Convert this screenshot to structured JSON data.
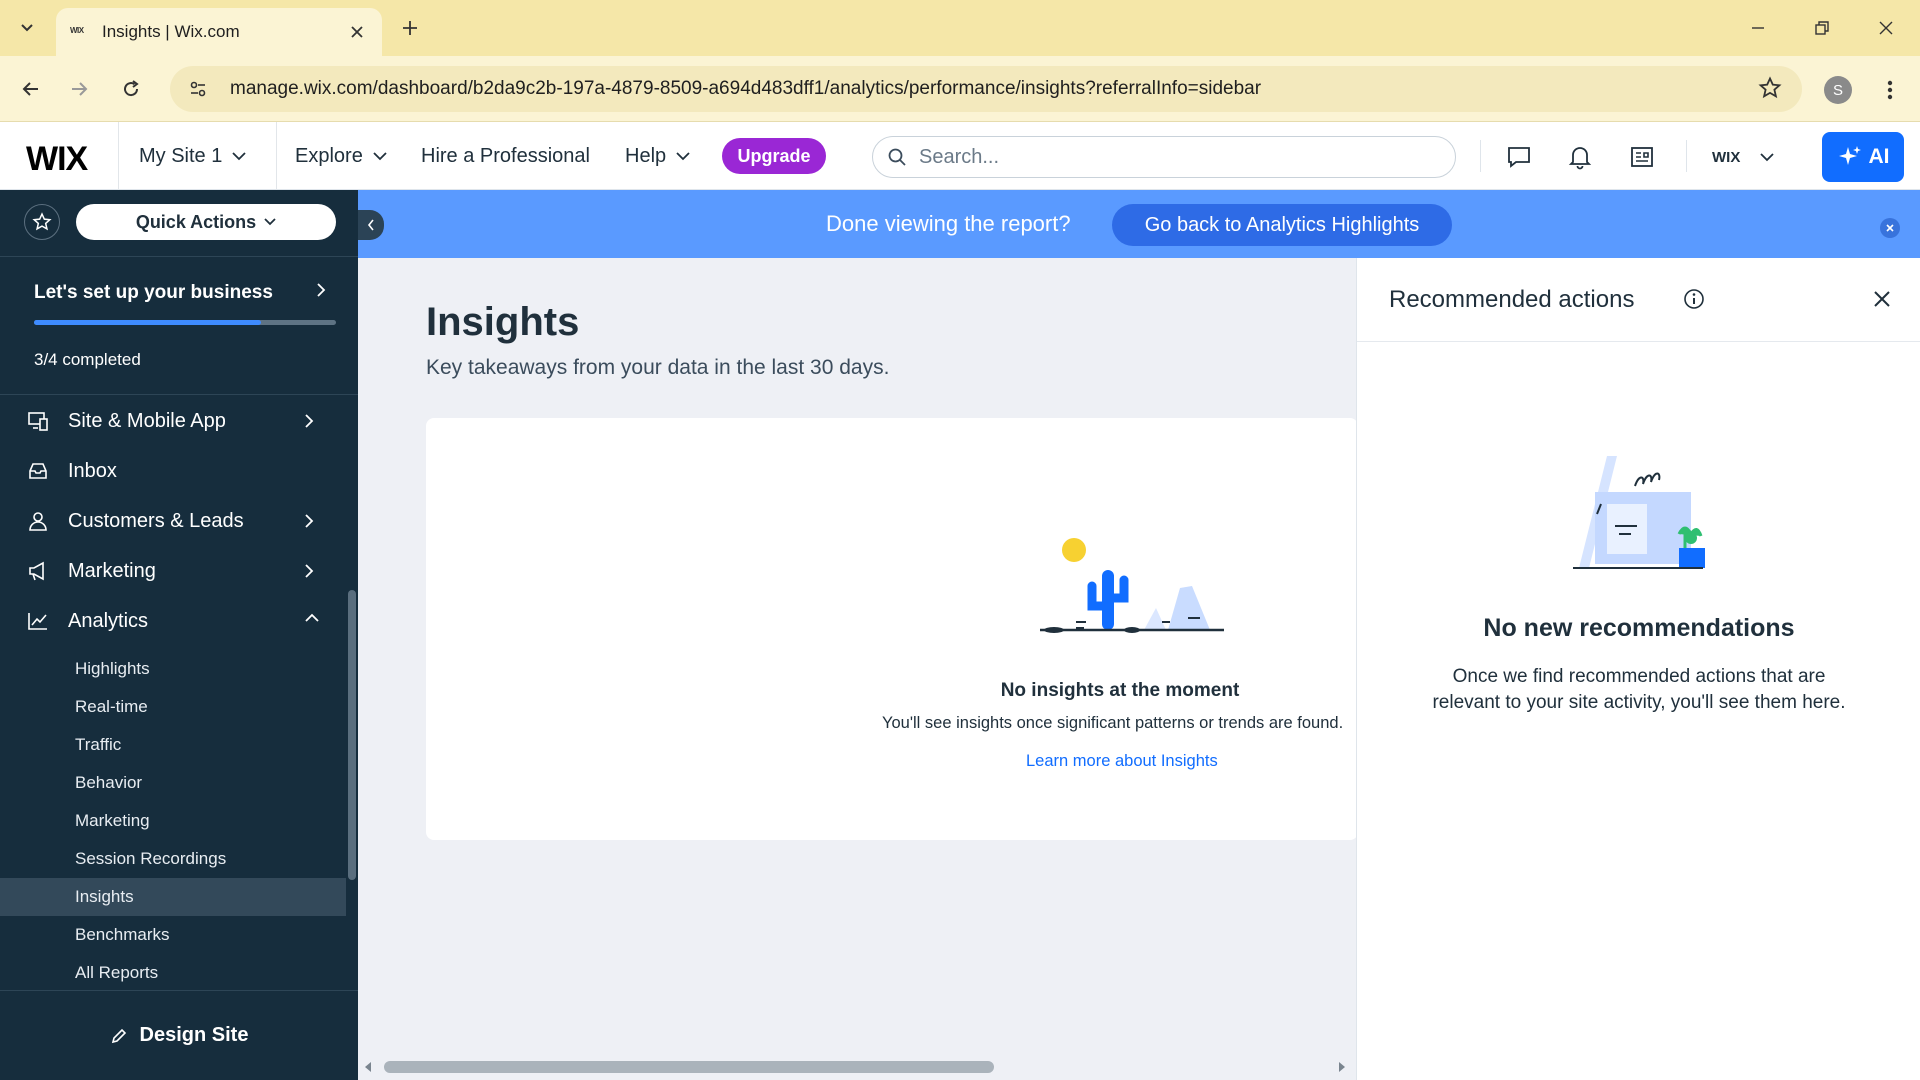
{
  "browser": {
    "tab_title": "Insights | Wix.com",
    "tab_favicon": "WIX",
    "url": "manage.wix.com/dashboard/b2da9c2b-197a-4879-8509-a694d483dff1/analytics/performance/insights?referralInfo=sidebar",
    "profile_initial": "S"
  },
  "header": {
    "logo": "WIX",
    "site_selector": "My Site 1",
    "explore": "Explore",
    "hire": "Hire a Professional",
    "help": "Help",
    "upgrade": "Upgrade",
    "search_placeholder": "Search...",
    "account_label": "WIX",
    "ai_label": "AI"
  },
  "sidebar": {
    "quick_actions": "Quick Actions",
    "setup_title": "Let's set up your business",
    "setup_progress": 0.75,
    "setup_count": "3/4 completed",
    "items": [
      {
        "label": "Site & Mobile App"
      },
      {
        "label": "Inbox"
      },
      {
        "label": "Customers & Leads"
      },
      {
        "label": "Marketing"
      },
      {
        "label": "Analytics"
      }
    ],
    "analytics_sub": [
      {
        "label": "Highlights"
      },
      {
        "label": "Real-time"
      },
      {
        "label": "Traffic"
      },
      {
        "label": "Behavior"
      },
      {
        "label": "Marketing"
      },
      {
        "label": "Session Recordings"
      },
      {
        "label": "Insights"
      },
      {
        "label": "Benchmarks"
      },
      {
        "label": "All Reports"
      }
    ],
    "design_site": "Design Site"
  },
  "banner": {
    "text": "Done viewing the report?",
    "button": "Go back to Analytics Highlights"
  },
  "main": {
    "title": "Insights",
    "subtitle": "Key takeaways from your data in the last 30 days.",
    "empty_title": "No insights at the moment",
    "empty_desc": "You'll see insights once significant patterns or trends are found.",
    "learn_more": "Learn more about Insights"
  },
  "panel": {
    "title": "Recommended actions",
    "empty_title": "No new recommendations",
    "empty_desc": "Once we find recommended actions that are relevant to your site activity, you'll see them here."
  },
  "colors": {
    "sidebar_bg": "#162d3d",
    "banner_bg": "#5a9aff",
    "upgrade_bg": "#9a27d5",
    "ai_bg": "#116dff",
    "link": "#116dff"
  }
}
